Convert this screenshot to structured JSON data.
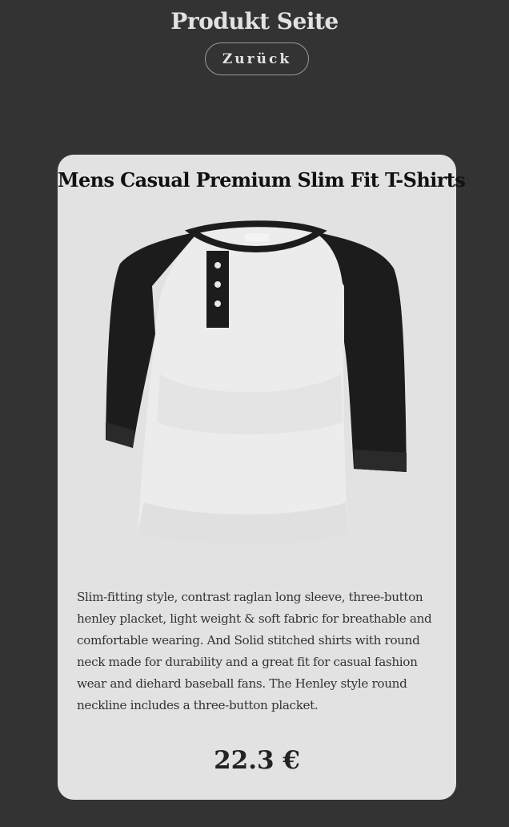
{
  "header": {
    "title": "Produkt Seite",
    "back_label": "Zurück"
  },
  "product": {
    "title": "Mens Casual Premium Slim Fit T-Shirts",
    "description": "Slim-fitting style, contrast raglan long sleeve, three-button henley placket, light weight & soft fabric for breathable and comfortable wearing. And Solid stitched shirts with round neck made for durability and a great fit for casual fashion wear and diehard baseball fans. The Henley style round neckline includes a three-button placket.",
    "price": "22.3 €",
    "image": {
      "body_color": "#ececec",
      "sleeve_color": "#1c1c1c"
    }
  },
  "colors": {
    "background": "#333333",
    "card": "#e2e2e2",
    "text_light": "#e2e2e2"
  }
}
